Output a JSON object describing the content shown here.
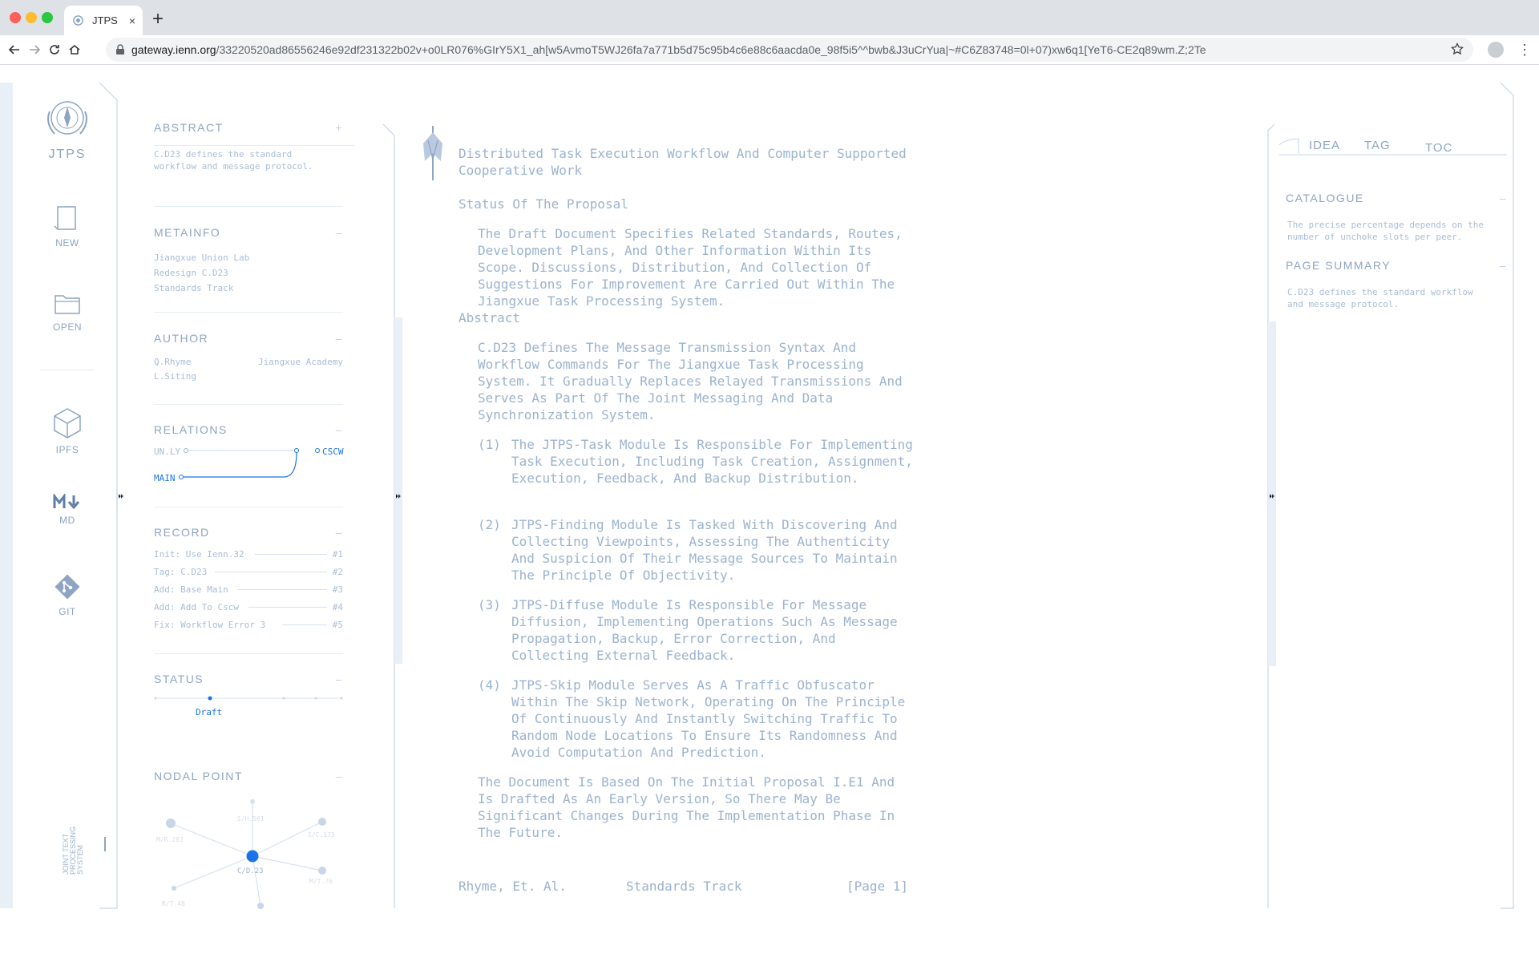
{
  "browser": {
    "tab_title": "JTPS",
    "tab_close": "×",
    "new_tab": "+",
    "url_host": "gateway.ienn.org",
    "url_path": "/33220520ad86556246e92df231322b02v+o0LR076%GIrY5X1_ah[w5AvmoT5WJ26fa7a771b5d75c95b4c6e88c6aacda0e_98f5i5^^bwb&J3uCrYua|~#C6Z83748=0l+07)xw6q1[YeT6-CE2q89wm.Z;2Te",
    "menu": "⋮"
  },
  "rail": {
    "logo_text": "JTPS",
    "new_label": "NEW",
    "open_label": "OPEN",
    "ipfs_label": "IPFS",
    "md_label": "MD",
    "git_label": "GIT",
    "brand_vertical": [
      "JOINT TEXT",
      "PROCESSING",
      "SYSTEM"
    ]
  },
  "sidebar": {
    "abstract": {
      "title": "ABSTRACT",
      "toggle": "+",
      "lines": [
        "C.D23 defines the standard",
        "workflow and message protocol."
      ]
    },
    "metainfo": {
      "title": "METAINFO",
      "toggle": "–",
      "lines": [
        "Jiangxue Union Lab",
        "Redesign C.D23",
        "Standards Track"
      ]
    },
    "author": {
      "title": "AUTHOR",
      "toggle": "–",
      "name1": "Q.Rhyme",
      "name2": "L.Siting",
      "org": "Jiangxue Academy"
    },
    "relations": {
      "title": "RELATIONS",
      "toggle": "–",
      "left_top": "UN.LY",
      "left_bottom": "MAIN",
      "right": "CSCW"
    },
    "record": {
      "title": "RECORD",
      "toggle": "–",
      "items": [
        {
          "text": "Init: Use Ienn.32",
          "tag": "#1"
        },
        {
          "text": "Tag: C.D23",
          "tag": "#2"
        },
        {
          "text": "Add: Base Main",
          "tag": "#3"
        },
        {
          "text": "Add: Add To Cscw",
          "tag": "#4"
        },
        {
          "text": "Fix: Workflow Error 3",
          "tag": "#5"
        }
      ]
    },
    "status": {
      "title": "STATUS",
      "toggle": "–",
      "value": "Draft"
    },
    "nodal": {
      "title": "NODAL POINT",
      "toggle": "–",
      "center": "C/D.23",
      "labels": [
        "S/H.561",
        "M/R.283",
        "S/C.173",
        "M/T.76",
        "R/T.48"
      ]
    }
  },
  "document": {
    "title_lines": [
      "Distributed Task Execution Workflow And Computer Supported",
      "Cooperative Work"
    ],
    "status_heading": "Status Of The Proposal",
    "status_lines": [
      "The Draft Document Specifies Related Standards, Routes,",
      "Development Plans, And Other Information Within Its",
      "Scope. Discussions, Distribution, And Collection Of",
      "Suggestions For Improvement Are Carried Out Within The",
      "Jiangxue Task Processing System."
    ],
    "abstract_heading": "Abstract",
    "abstract_lines": [
      "C.D23 Defines The Message Transmission Syntax And",
      "Workflow Commands For The Jiangxue Task Processing",
      "System. It Gradually Replaces Relayed Transmissions And",
      "Serves As Part Of The Joint Messaging And Data",
      "Synchronization System."
    ],
    "items": [
      {
        "num": "(1)",
        "lines": [
          "The JTPS-Task Module Is Responsible For Implementing",
          "Task Execution, Including Task Creation, Assignment,",
          "Execution, Feedback, And Backup Distribution."
        ]
      },
      {
        "num": "(2)",
        "lines": [
          "JTPS-Finding Module Is Tasked With Discovering And",
          "Collecting Viewpoints, Assessing The Authenticity",
          "And Suspicion Of Their Message Sources To Maintain",
          "The Principle Of Objectivity."
        ]
      },
      {
        "num": "(3)",
        "lines": [
          "JTPS-Diffuse Module Is Responsible For Message",
          "Diffusion, Implementing Operations Such As Message",
          "Propagation, Backup, Error Correction, And",
          "Collecting External Feedback."
        ]
      },
      {
        "num": "(4)",
        "lines": [
          "JTPS-Skip Module Serves As A Traffic Obfuscator",
          "Within The Skip Network, Operating On The Principle",
          "Of Continuously And Instantly Switching Traffic To",
          "Random Node Locations To Ensure Its Randomness And",
          "Avoid Computation And Prediction."
        ]
      }
    ],
    "closing_lines": [
      "The Document Is Based On The Initial Proposal I.E1 And",
      "Is Drafted As An Early Version, So There May Be",
      "Significant Changes During The Implementation Phase In",
      "The Future."
    ],
    "footer_left": "Rhyme, Et. Al.",
    "footer_mid": "Standards Track",
    "footer_right": "[Page 1]"
  },
  "right_panel": {
    "tabs": [
      "IDEA",
      "TAG",
      "TOC"
    ],
    "catalogue": {
      "title": "CATALOGUE",
      "toggle": "–",
      "lines": [
        "The precise percentage depends on the",
        "number of unchoke slots per peer."
      ]
    },
    "page_summary": {
      "title": "PAGE SUMMARY",
      "toggle": "–",
      "lines": [
        "C.D23 defines the standard workflow",
        "and message protocol."
      ]
    }
  },
  "colors": {
    "accent": "#1a73e8",
    "ink": "#9bb3cf",
    "line": "#c7d6e8"
  }
}
